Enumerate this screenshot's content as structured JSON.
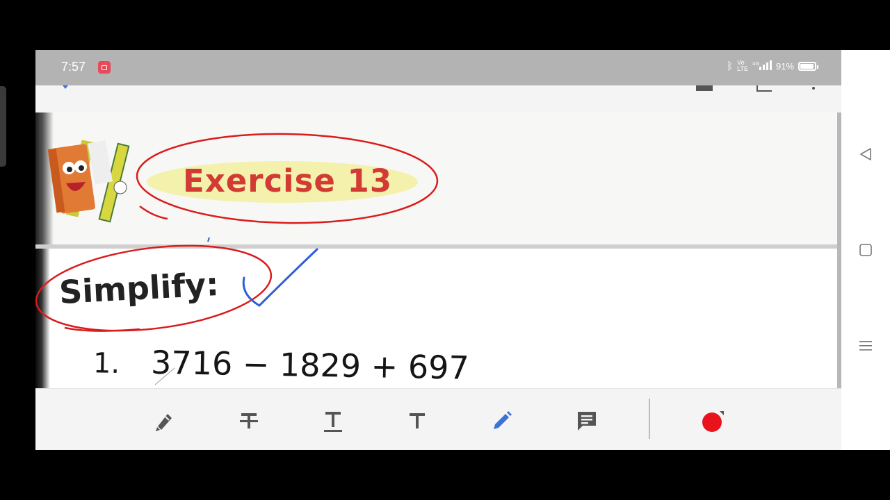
{
  "status_bar": {
    "time": "7:57",
    "battery": "91%",
    "icons": [
      "screen-record-icon",
      "bluetooth-icon",
      "volte-icon",
      "signal-icon",
      "battery-icon"
    ]
  },
  "document": {
    "page1": {
      "heading": "Exercise 13"
    },
    "page2": {
      "instruction": "Simplify:",
      "problem_number": "1.",
      "problem_expression": "3716 − 1829 + 697"
    }
  },
  "toolbar": {
    "tools": [
      {
        "name": "highlighter-tool",
        "icon": "highlighter-icon"
      },
      {
        "name": "strikethrough-tool",
        "icon": "strikethrough-text-icon"
      },
      {
        "name": "underline-tool",
        "icon": "underline-text-icon"
      },
      {
        "name": "text-tool",
        "icon": "text-icon"
      },
      {
        "name": "pen-tool",
        "icon": "pencil-icon",
        "active": true
      },
      {
        "name": "comment-tool",
        "icon": "comment-icon"
      },
      {
        "name": "color-picker",
        "icon": "color-dot-icon"
      }
    ],
    "active_color": "#e8131b",
    "accent": "#3b73d9"
  },
  "navigation": {
    "buttons": [
      "back-icon",
      "home-icon",
      "recents-icon"
    ]
  }
}
